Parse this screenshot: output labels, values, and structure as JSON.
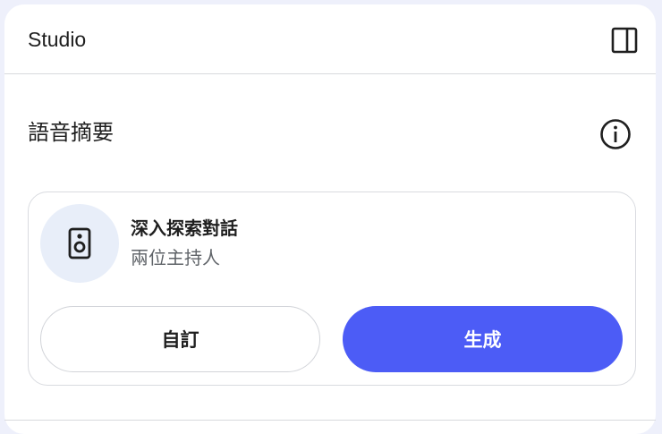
{
  "header": {
    "title": "Studio",
    "toggle_icon": "side-panel-icon"
  },
  "audio_overview": {
    "title": "語音摘要",
    "info_icon": "info-icon",
    "card": {
      "icon": "speaker-icon",
      "title": "深入探索對話",
      "subtitle": "兩位主持人",
      "customize_label": "自訂",
      "generate_label": "生成"
    }
  },
  "colors": {
    "primary": "#4c5cf6",
    "icon_bg": "#e8eef9",
    "page_bg": "#eef0fb"
  }
}
